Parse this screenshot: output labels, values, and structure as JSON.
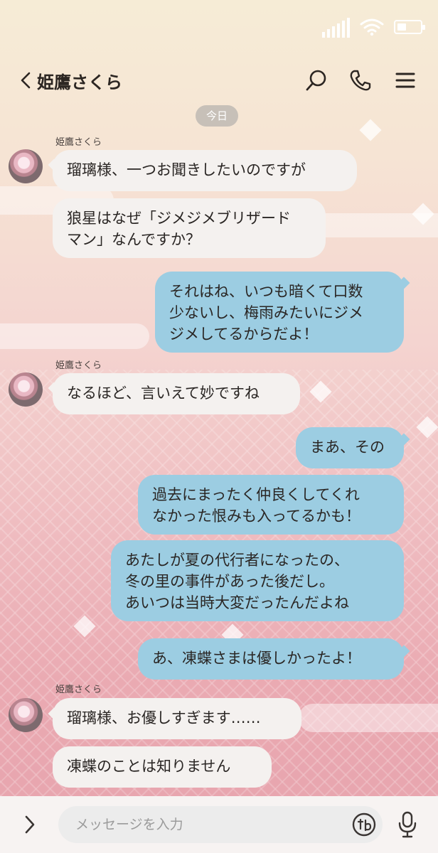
{
  "header": {
    "contact_name": "姫鷹さくら"
  },
  "date_chip": "今日",
  "messages": [
    {
      "side": "in",
      "sender": "姫鷹さくら",
      "text": "瑠璃様、一つお聞きしたいのですが"
    },
    {
      "side": "in",
      "sender": "",
      "text": "狼星はなぜ「ジメジメブリザード\nマン」なんですか？"
    },
    {
      "side": "out",
      "text": "それはね、いつも暗くて口数\n少ないし、梅雨みたいにジメ\nジメしてるからだよ！"
    },
    {
      "side": "in",
      "sender": "姫鷹さくら",
      "text": "なるほど、言いえて妙ですね"
    },
    {
      "side": "out",
      "text": "まあ、その"
    },
    {
      "side": "out",
      "text": "過去にまったく仲良くしてくれ\nなかった恨みも入ってるかも！"
    },
    {
      "side": "out",
      "text": "あたしが夏の代行者になったの、\n冬の里の事件があった後だし。\nあいつは当時大変だったんだよね"
    },
    {
      "side": "out",
      "text": "あ、凍蝶さまは優しかったよ！"
    },
    {
      "side": "in",
      "sender": "姫鷹さくら",
      "text": "瑠璃様、お優しすぎます……"
    },
    {
      "side": "in",
      "sender": "",
      "text": "凍蝶のことは知りません"
    }
  ],
  "input": {
    "placeholder": "メッセージを入力"
  },
  "icons": {
    "back": "chevron-left-icon",
    "search": "search-icon",
    "call": "phone-icon",
    "menu": "hamburger-menu-icon",
    "expand": "chevron-right-icon",
    "sticker": "sticker-icon",
    "mic": "microphone-icon",
    "signal": "signal-icon",
    "wifi": "wifi-icon",
    "battery": "battery-icon"
  },
  "colors": {
    "incoming_bubble": "#f4f1ef",
    "outgoing_bubble": "#9ccde2",
    "text": "#2a2624"
  }
}
